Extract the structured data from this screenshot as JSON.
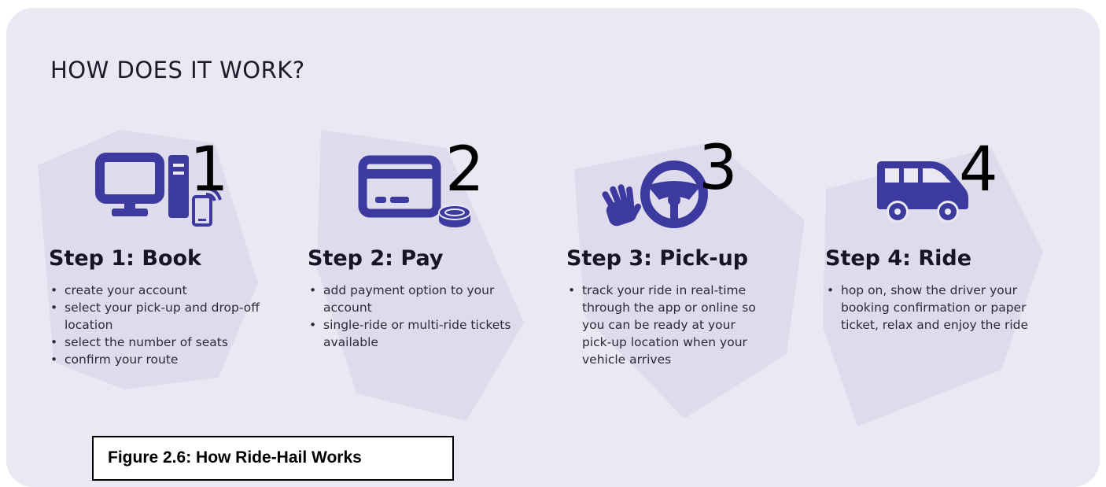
{
  "title": "HOW DOES IT WORK?",
  "colors": {
    "panel_background": "#e9e8f3",
    "background_shape": "#dedcec",
    "icon": "#3c3a9f",
    "step_number": "#000000"
  },
  "steps": [
    {
      "number": "1",
      "icon": "desktop-computer-and-phone-icon",
      "title": "Step 1: Book",
      "bullets": [
        "create your account",
        "select your pick-up and drop-off location",
        "select the number of seats",
        "confirm your route"
      ]
    },
    {
      "number": "2",
      "icon": "credit-card-and-coin-icon",
      "title": "Step 2: Pay",
      "bullets": [
        "add payment option to your account",
        "single-ride or multi-ride tickets available"
      ]
    },
    {
      "number": "3",
      "icon": "waving-hand-and-steering-wheel-icon",
      "title": "Step 3: Pick-up",
      "bullets": [
        "track your ride in real-time through the app or online so you can be ready at your pick-up location when your vehicle arrives"
      ]
    },
    {
      "number": "4",
      "icon": "van-icon",
      "title": "Step 4: Ride",
      "bullets": [
        "hop on, show the driver your booking confirmation or paper ticket, relax and enjoy the ride"
      ]
    }
  ],
  "caption": "Figure 2.6: How Ride-Hail Works"
}
